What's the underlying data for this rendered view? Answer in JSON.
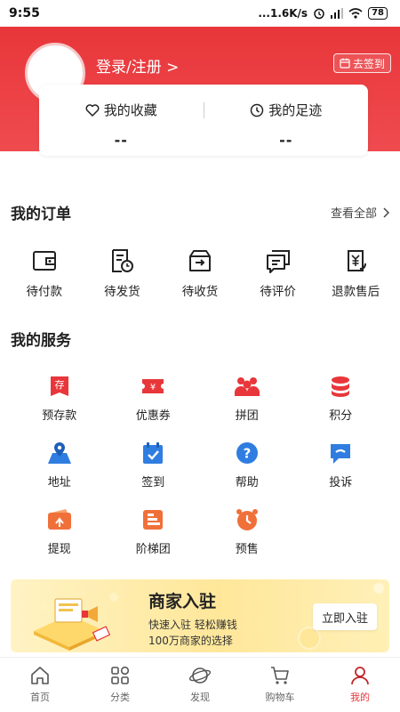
{
  "status_bar": {
    "time": "9:55",
    "network_speed": "...1.6K/s",
    "battery": "78"
  },
  "header": {
    "login_text": "登录/注册 >",
    "checkin_label": "去签到"
  },
  "favorites": {
    "collection_label": "我的收藏",
    "collection_count": "--",
    "history_label": "我的足迹",
    "history_count": "--"
  },
  "orders": {
    "title": "我的订单",
    "view_all": "查看全部",
    "items": [
      {
        "label": "待付款",
        "icon": "wallet-icon"
      },
      {
        "label": "待发货",
        "icon": "shipping-doc-icon"
      },
      {
        "label": "待收货",
        "icon": "receive-box-icon"
      },
      {
        "label": "待评价",
        "icon": "review-chat-icon"
      },
      {
        "label": "退款售后",
        "icon": "refund-icon"
      }
    ]
  },
  "services": {
    "title": "我的服务",
    "items": [
      {
        "label": "预存款",
        "icon": "deposit-icon",
        "color": "#e8363a"
      },
      {
        "label": "优惠券",
        "icon": "coupon-icon",
        "color": "#e8363a"
      },
      {
        "label": "拼团",
        "icon": "group-icon",
        "color": "#e8363a"
      },
      {
        "label": "积分",
        "icon": "points-icon",
        "color": "#e8363a"
      },
      {
        "label": "地址",
        "icon": "location-icon",
        "color": "#2f7de0"
      },
      {
        "label": "签到",
        "icon": "checkin-icon",
        "color": "#2f7de0"
      },
      {
        "label": "帮助",
        "icon": "help-icon",
        "color": "#2f7de0"
      },
      {
        "label": "投诉",
        "icon": "complaint-icon",
        "color": "#2f7de0"
      },
      {
        "label": "提现",
        "icon": "withdraw-icon",
        "color": "#f0703a"
      },
      {
        "label": "阶梯团",
        "icon": "tier-group-icon",
        "color": "#f0703a"
      },
      {
        "label": "预售",
        "icon": "presale-icon",
        "color": "#f0703a"
      }
    ]
  },
  "banner": {
    "title": "商家入驻",
    "subtitle1": "快速入驻 轻松赚钱",
    "subtitle2": "100万商家的选择",
    "button": "立即入驻"
  },
  "tabbar": {
    "tabs": [
      {
        "label": "首页",
        "icon": "home-icon"
      },
      {
        "label": "分类",
        "icon": "category-icon"
      },
      {
        "label": "发现",
        "icon": "discover-icon"
      },
      {
        "label": "购物车",
        "icon": "cart-icon"
      },
      {
        "label": "我的",
        "icon": "profile-icon",
        "active": true
      }
    ]
  },
  "colors": {
    "brand_red": "#e8363a",
    "service_blue": "#2f7de0",
    "service_orange": "#f0703a"
  }
}
